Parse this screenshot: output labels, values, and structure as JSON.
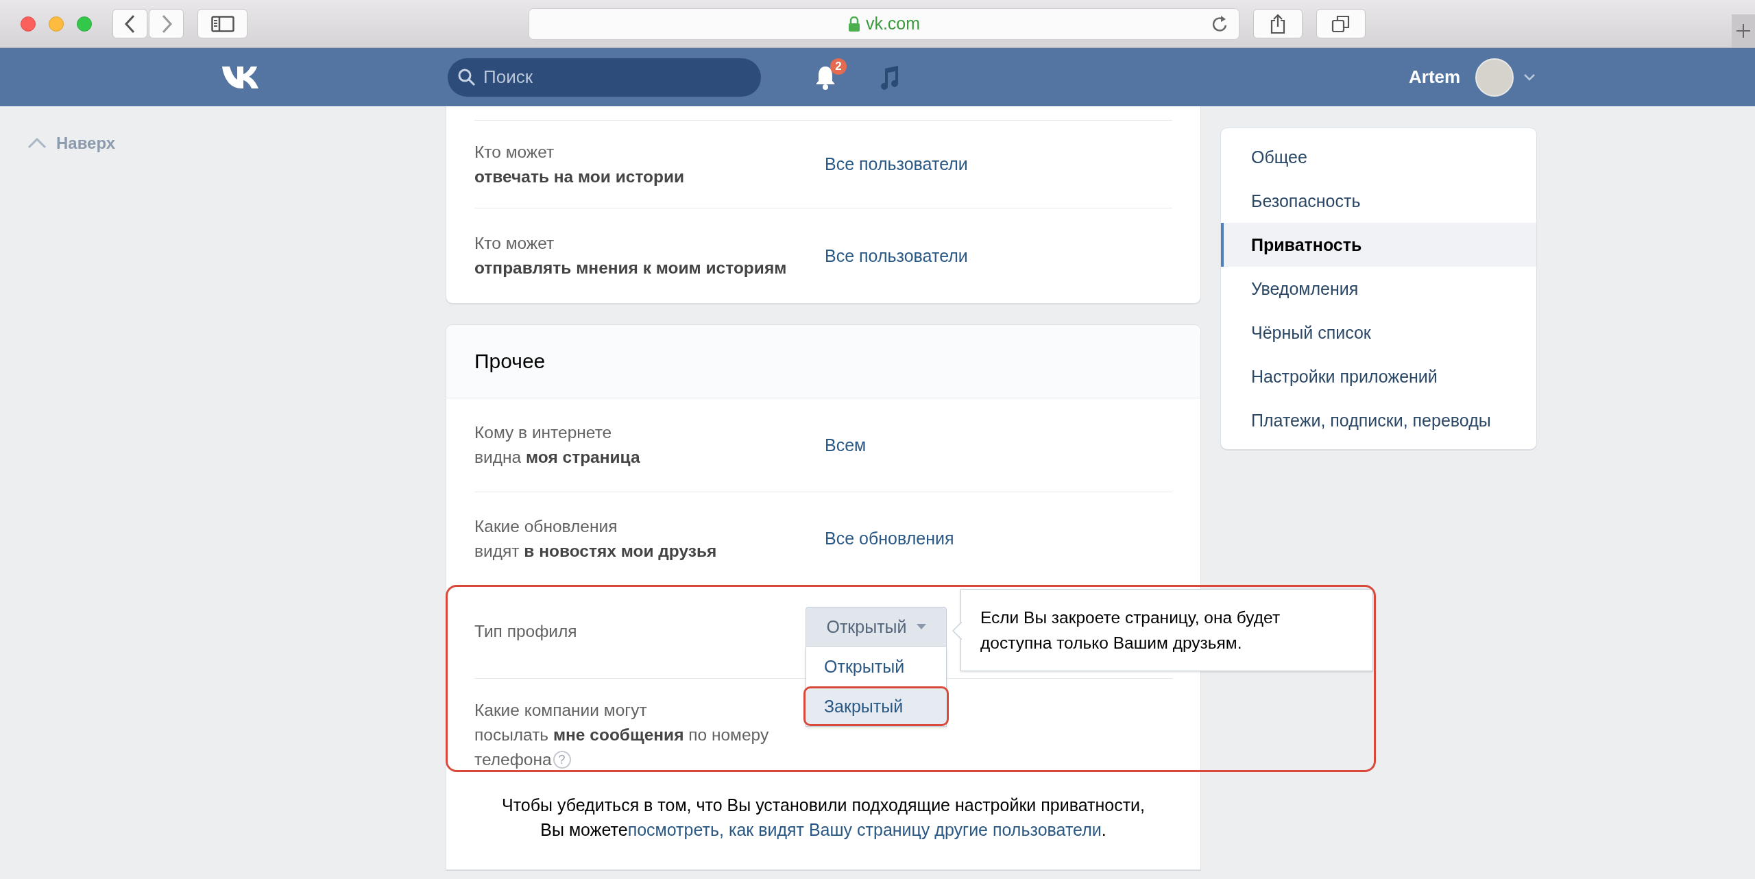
{
  "browser": {
    "url": "vk.com"
  },
  "header": {
    "search": {
      "placeholder": "Поиск"
    },
    "notifications": {
      "badge": "2"
    },
    "user": {
      "name": "Artem"
    }
  },
  "back_to_top": {
    "label": "Наверх"
  },
  "cards": [
    {
      "rows": [
        {
          "kind": "link",
          "label": "Кто может\n**отвечать на мои истории**",
          "value": "Все пользователи"
        },
        {
          "kind": "link",
          "label": "Кто может\n**отправлять мнения к моим историям**",
          "value": "Все пользователи"
        }
      ]
    },
    {
      "title": "Прочее",
      "rows": [
        {
          "kind": "link",
          "label": "Кому в интернете\nвидна **моя страница**",
          "value": "Всем"
        },
        {
          "kind": "link",
          "label": "Какие обновления\nвидят **в новостях мои друзья**",
          "value": "Все обновления"
        }
      ],
      "highlighted_rows": [
        {
          "kind": "dropdown",
          "label": "Тип профиля",
          "dropdown": {
            "value": "Открытый",
            "open": true,
            "options": [
              {
                "label": "Открытый",
                "hovered": false,
                "outlined": false
              },
              {
                "label": "Закрытый",
                "hovered": true,
                "outlined": true
              }
            ]
          },
          "tooltip": "Если Вы закроете страницу, она будет\nдоступна только Вашим друзьям."
        },
        {
          "kind": "empty",
          "label": "Какие компании могут\nпосылать **мне сообщения** по номеру",
          "label_end": "телефона",
          "help": "?"
        }
      ],
      "note": {
        "text": "Чтобы убедиться в том, что Вы установили подходящие настройки приватности,\nВы можете",
        "link": "посмотреть, как видят Вашу страницу другие пользователи",
        "after": "."
      }
    }
  ],
  "menu": [
    {
      "label": "Общее",
      "selected": false
    },
    {
      "label": "Безопасность",
      "selected": false
    },
    {
      "label": "Приватность",
      "selected": true
    },
    {
      "label": "Уведомления",
      "selected": false
    },
    {
      "label": "Чёрный список",
      "selected": false
    },
    {
      "label": "Настройки приложений",
      "selected": false
    },
    {
      "label": "Платежи, подписки, переводы",
      "selected": false
    }
  ]
}
